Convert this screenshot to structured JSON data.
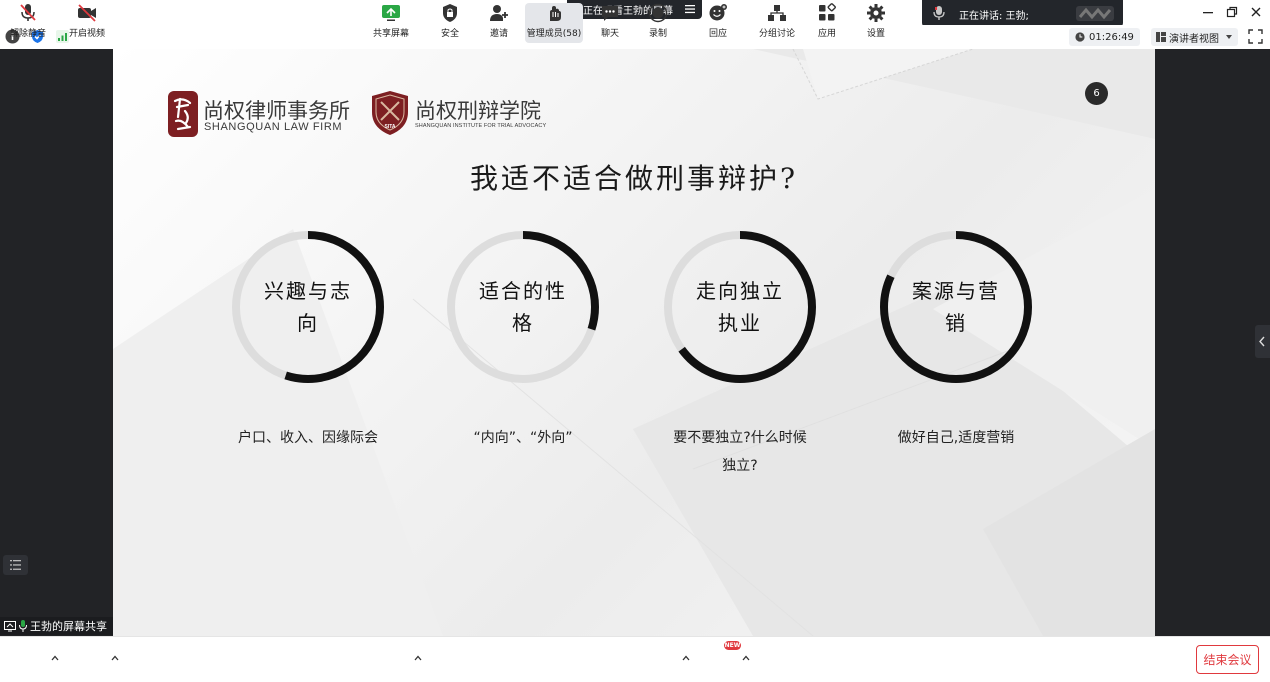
{
  "top": {
    "viewing_text": "您正在观看王勃的屏幕",
    "speaking_text": "正在讲话: 王勃;",
    "timer": "01:26:49",
    "view_mode": "演讲者视图"
  },
  "slide": {
    "page_number": "6",
    "logo_a": {
      "cn": "尚权律师事务所",
      "en": "SHANGQUAN LAW FIRM"
    },
    "logo_b": {
      "cn": "尚权刑辩学院",
      "en": "SHANGQUAN INSTITUTE FOR TRIAL ADVOCACY",
      "badge": "SITA"
    },
    "title": "我适不适合做刑事辩护?",
    "rings": [
      {
        "line1": "兴趣与志",
        "line2": "向",
        "caption1": "户口、收入、因缘际会",
        "caption2": "",
        "progress": 0.55
      },
      {
        "line1": "适合的性",
        "line2": "格",
        "caption1": "“内向”、“外向”",
        "caption2": "",
        "progress": 0.3
      },
      {
        "line1": "走向独立",
        "line2": "执业",
        "caption1": "要不要独立?什么时候",
        "caption2": "独立?",
        "progress": 0.65
      },
      {
        "line1": "案源与营",
        "line2": "销",
        "caption1": "做好自己,适度营销",
        "caption2": "",
        "progress": 0.82
      }
    ]
  },
  "share_label": "王勃的屏幕共享",
  "toolbar": {
    "unmute": "解除静音",
    "start_video": "开启视频",
    "share_screen": "共享屏幕",
    "security": "安全",
    "invite": "邀请",
    "manage_members": "管理成员(58)",
    "chat": "聊天",
    "record": "录制",
    "reactions": "回应",
    "new_badge": "NEW",
    "breakout": "分组讨论",
    "apps": "应用",
    "settings": "设置",
    "end_meeting": "结束会议"
  },
  "colors": {
    "end_red": "#e0393e",
    "ring_black": "#111111",
    "ring_gray": "#dddddd",
    "logo_red": "#7d1f22"
  }
}
